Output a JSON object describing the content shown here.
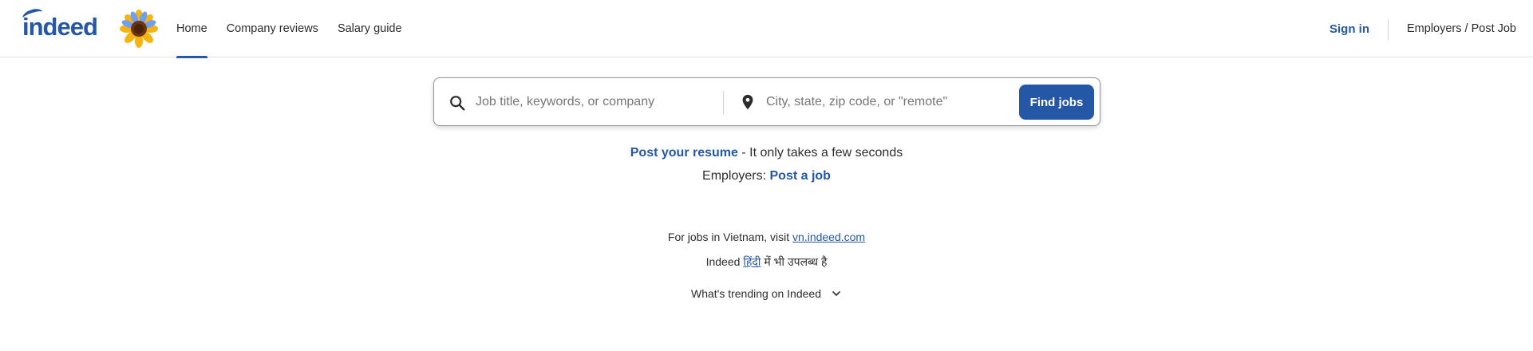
{
  "header": {
    "logo_text": "indeed",
    "nav": [
      {
        "label": "Home",
        "active": true
      },
      {
        "label": "Company reviews",
        "active": false
      },
      {
        "label": "Salary guide",
        "active": false
      }
    ],
    "sign_in": "Sign in",
    "employers": "Employers / Post Job"
  },
  "search": {
    "what_placeholder": "Job title, keywords, or company",
    "what_value": "",
    "where_placeholder": "City, state, zip code, or \"remote\"",
    "where_value": "",
    "button": "Find jobs"
  },
  "promo": {
    "resume_link": "Post your resume",
    "resume_suffix": " - It only takes a few seconds",
    "employers_prefix": "Employers: ",
    "post_job_link": "Post a job"
  },
  "locale": {
    "vietnam_prefix": "For jobs in Vietnam, visit ",
    "vietnam_link": "vn.indeed.com",
    "hindi_prefix": "Indeed ",
    "hindi_link": "हिंदी",
    "hindi_suffix": " में भी उपलब्ध है"
  },
  "trending": {
    "label": "What's trending on Indeed"
  },
  "icons": {
    "search": "search-icon",
    "location": "location-pin-icon",
    "chevron": "chevron-down-icon",
    "sunflower": "sunflower-icon"
  },
  "colors": {
    "brand": "#2557a7",
    "text": "#2d2d2d",
    "border": "#e4e2e0"
  }
}
